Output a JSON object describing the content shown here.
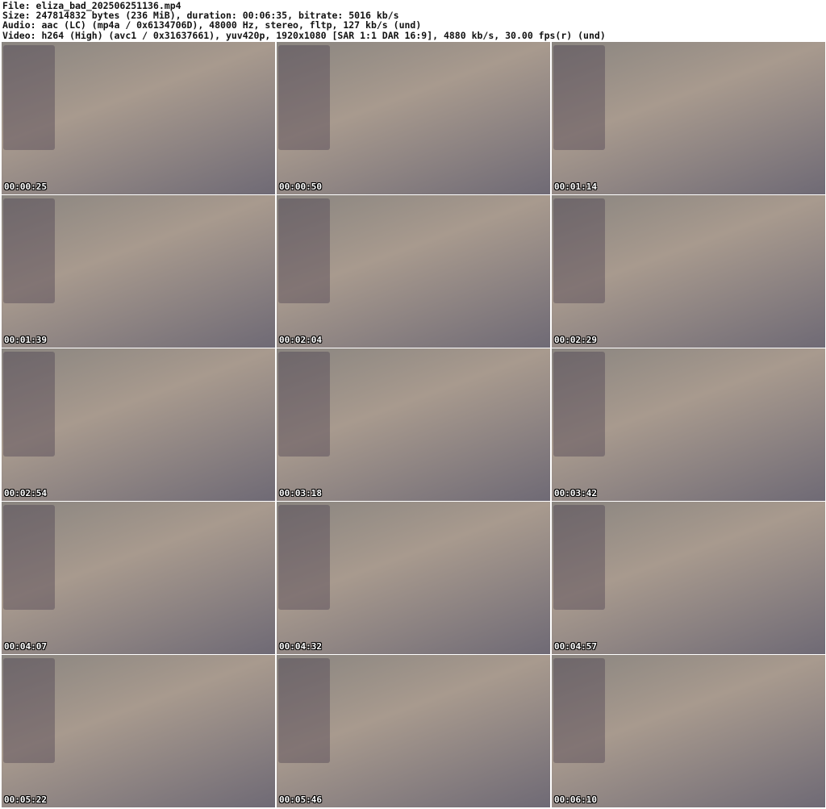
{
  "header": {
    "file": "File: eliza_bad_202506251136.mp4",
    "size": "Size: 247814832 bytes (236 MiB), duration: 00:06:35, bitrate: 5016 kb/s",
    "audio": "Audio: aac (LC) (mp4a / 0x6134706D), 48000 Hz, stereo, fltp, 127 kb/s (und)",
    "video": "Video: h264 (High) (avc1 / 0x31637661), yuv420p, 1920x1080 [SAR 1:1 DAR 16:9], 4880 kb/s, 30.00 fps(r) (und)"
  },
  "thumbnails": [
    {
      "timestamp": "00:00:25"
    },
    {
      "timestamp": "00:00:50"
    },
    {
      "timestamp": "00:01:14"
    },
    {
      "timestamp": "00:01:39"
    },
    {
      "timestamp": "00:02:04"
    },
    {
      "timestamp": "00:02:29"
    },
    {
      "timestamp": "00:02:54"
    },
    {
      "timestamp": "00:03:18"
    },
    {
      "timestamp": "00:03:42"
    },
    {
      "timestamp": "00:04:07"
    },
    {
      "timestamp": "00:04:32"
    },
    {
      "timestamp": "00:04:57"
    },
    {
      "timestamp": "00:05:22"
    },
    {
      "timestamp": "00:05:46"
    },
    {
      "timestamp": "00:06:10"
    }
  ]
}
